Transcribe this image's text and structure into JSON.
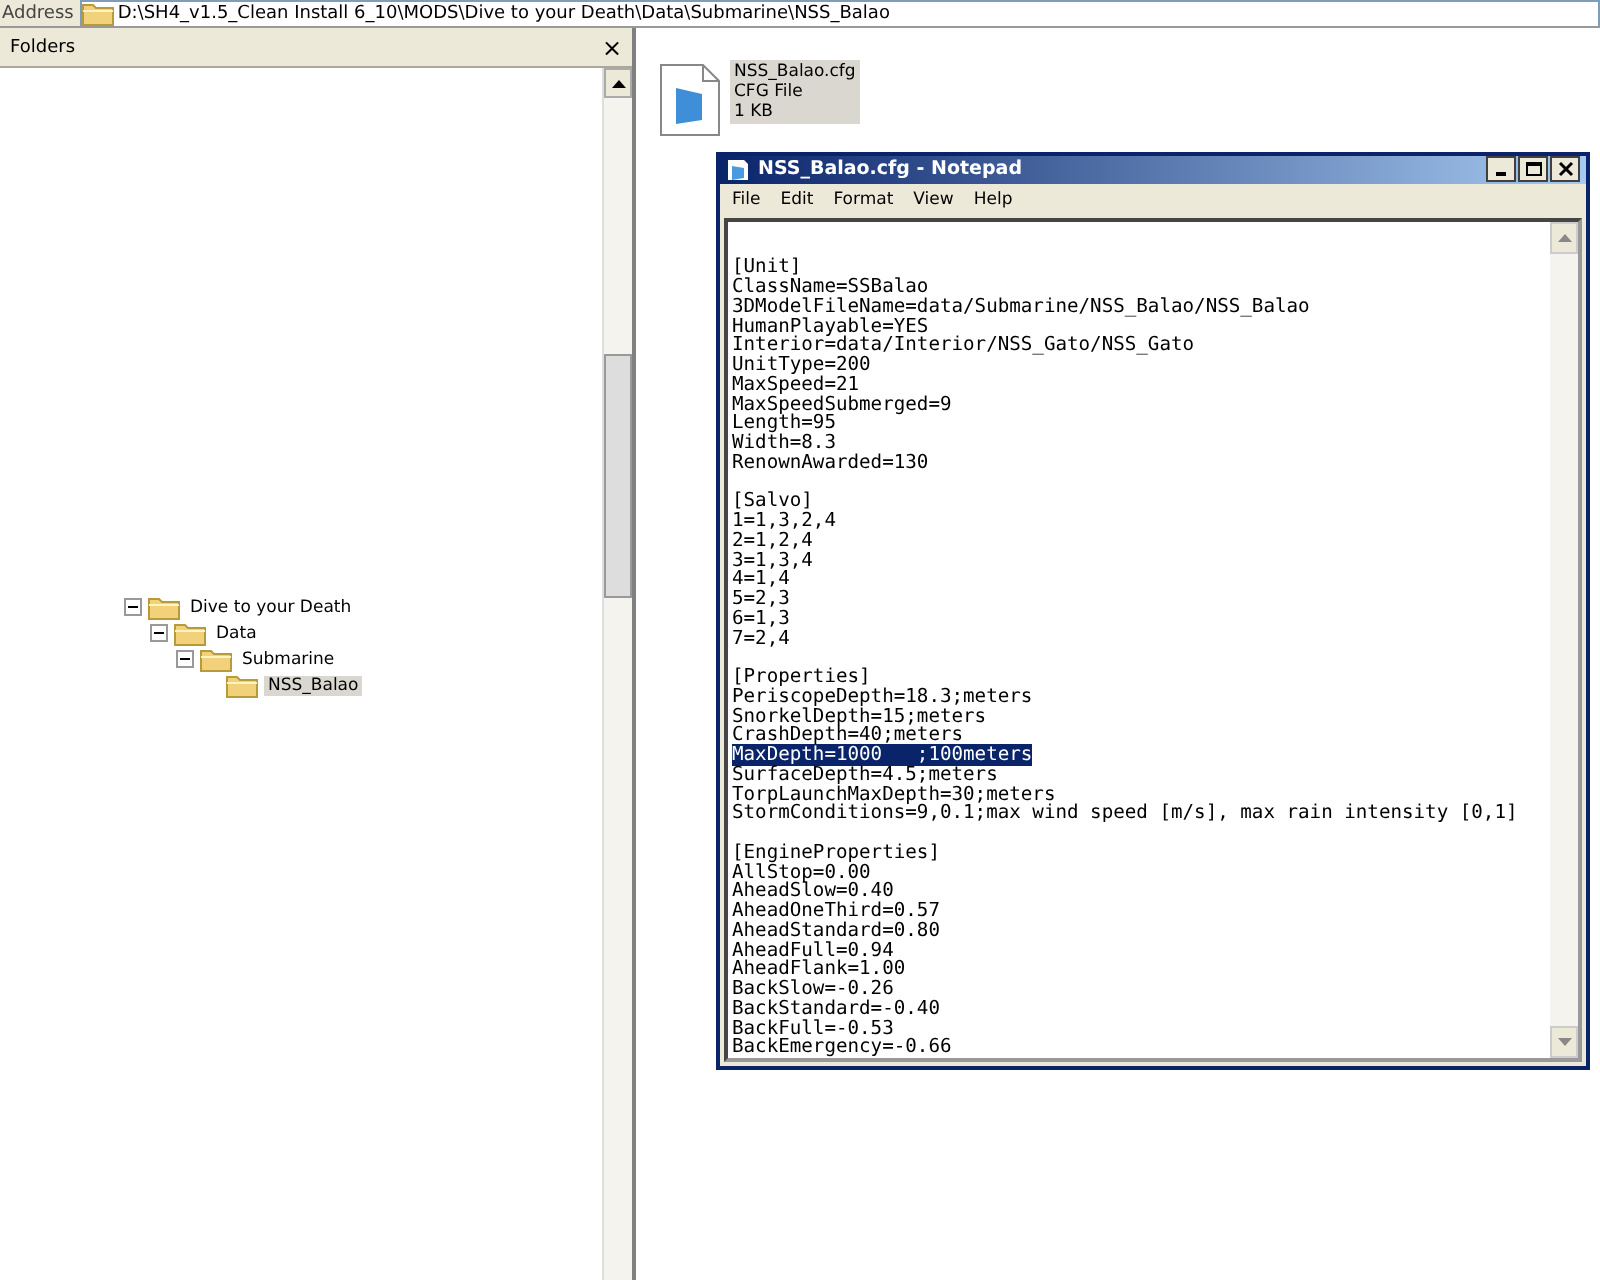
{
  "address_bar": {
    "label": "Address",
    "path": "D:\\SH4_v1.5_Clean Install 6_10\\MODS\\Dive to your Death\\Data\\Submarine\\NSS_Balao"
  },
  "folders_pane": {
    "title": "Folders",
    "close": "×",
    "tree": [
      {
        "label": "Dive to your Death",
        "expanded": true,
        "selected": false,
        "children": [
          {
            "label": "Data",
            "expanded": true,
            "selected": false,
            "children": [
              {
                "label": "Submarine",
                "expanded": true,
                "selected": false,
                "children": [
                  {
                    "label": "NSS_Balao",
                    "selected": true
                  }
                ]
              }
            ]
          }
        ]
      }
    ]
  },
  "file_item": {
    "name": "NSS_Balao.cfg",
    "type": "CFG File",
    "size": "1 KB",
    "selected": true
  },
  "notepad": {
    "title": "NSS_Balao.cfg - Notepad",
    "menu": [
      "File",
      "Edit",
      "Format",
      "View",
      "Help"
    ],
    "sections": [
      {
        "lines": [
          {
            "text": "[Unit]",
            "selected": false
          },
          {
            "text": "ClassName=SSBalao",
            "selected": false
          },
          {
            "text": "3DModelFileName=data/Submarine/NSS_Balao/NSS_Balao",
            "selected": false
          },
          {
            "text": "HumanPlayable=YES",
            "selected": false
          },
          {
            "text": "Interior=data/Interior/NSS_Gato/NSS_Gato",
            "selected": false
          },
          {
            "text": "UnitType=200",
            "selected": false
          },
          {
            "text": "MaxSpeed=21",
            "selected": false
          },
          {
            "text": "MaxSpeedSubmerged=9",
            "selected": false
          },
          {
            "text": "Length=95",
            "selected": false
          },
          {
            "text": "Width=8.3",
            "selected": false
          },
          {
            "text": "RenownAwarded=130",
            "selected": false
          }
        ]
      },
      {
        "lines": [
          {
            "text": "[Salvo]",
            "selected": false
          },
          {
            "text": "1=1,3,2,4",
            "selected": false
          },
          {
            "text": "2=1,2,4",
            "selected": false
          },
          {
            "text": "3=1,3,4",
            "selected": false
          },
          {
            "text": "4=1,4",
            "selected": false
          },
          {
            "text": "5=2,3",
            "selected": false
          },
          {
            "text": "6=1,3",
            "selected": false
          },
          {
            "text": "7=2,4",
            "selected": false
          }
        ]
      },
      {
        "lines": [
          {
            "text": "[Properties]",
            "selected": false
          },
          {
            "text": "PeriscopeDepth=18.3;meters",
            "selected": false
          },
          {
            "text": "SnorkelDepth=15;meters",
            "selected": false
          },
          {
            "text": "CrashDepth=40;meters",
            "selected": false
          },
          {
            "text": "MaxDepth=1000   ;100meters",
            "selected": true
          },
          {
            "text": "SurfaceDepth=4.5;meters",
            "selected": false
          },
          {
            "text": "TorpLaunchMaxDepth=30;meters",
            "selected": false
          },
          {
            "text": "StormConditions=9,0.1;max wind speed [m/s], max rain intensity [0,1]",
            "selected": false
          }
        ]
      },
      {
        "lines": [
          {
            "text": "[EngineProperties]",
            "selected": false
          },
          {
            "text": "AllStop=0.00",
            "selected": false
          },
          {
            "text": "AheadSlow=0.40",
            "selected": false
          },
          {
            "text": "AheadOneThird=0.57",
            "selected": false
          },
          {
            "text": "AheadStandard=0.80",
            "selected": false
          },
          {
            "text": "AheadFull=0.94",
            "selected": false
          },
          {
            "text": "AheadFlank=1.00",
            "selected": false
          },
          {
            "text": "BackSlow=-0.26",
            "selected": false
          },
          {
            "text": "BackStandard=-0.40",
            "selected": false
          },
          {
            "text": "BackFull=-0.53",
            "selected": false
          },
          {
            "text": "BackEmergency=-0.66",
            "selected": false
          }
        ]
      }
    ]
  }
}
